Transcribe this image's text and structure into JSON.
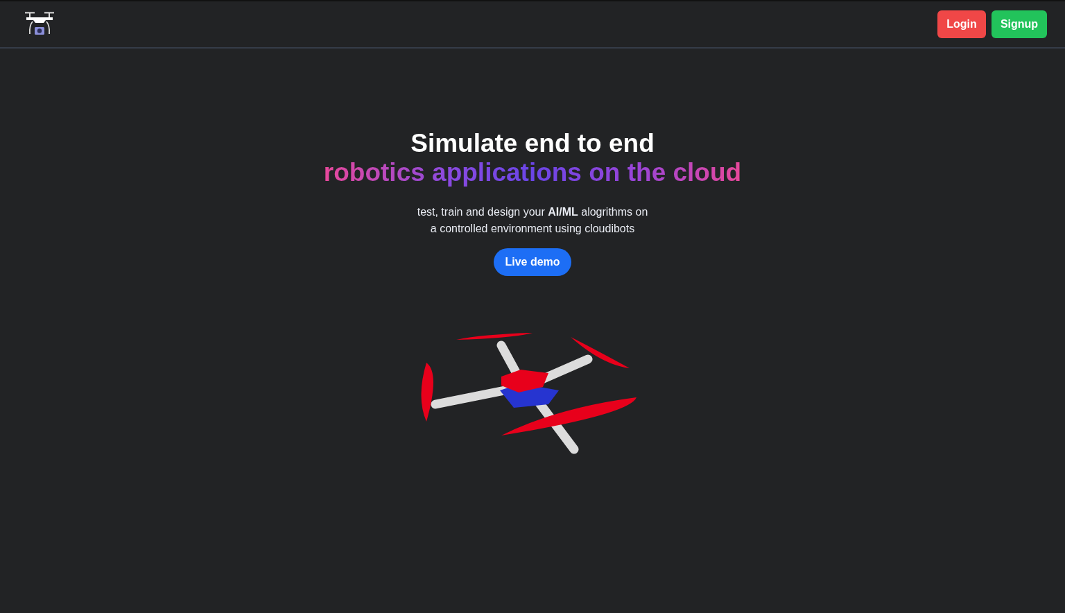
{
  "navbar": {
    "buttons": [
      {
        "label": "Login",
        "kind": "login"
      },
      {
        "label": "Signup",
        "kind": "signup"
      }
    ]
  },
  "hero": {
    "title": "Simulate end to end",
    "title_highlight": "robotics applications on the cloud",
    "subtitle_lines": [
      "test, train and design your **AI/ML** alogrithms on",
      "a controlled environment using cloudibots"
    ],
    "cta": "Live demo"
  }
}
